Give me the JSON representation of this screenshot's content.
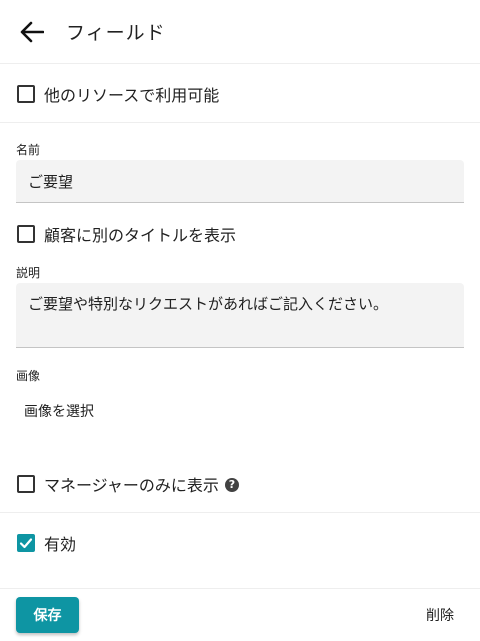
{
  "header": {
    "title": "フィールド"
  },
  "options": {
    "available_other_resources_label": "他のリソースで利用可能",
    "show_different_title_label": "顧客に別のタイトルを表示",
    "managers_only_label": "マネージャーのみに表示",
    "enabled_label": "有効"
  },
  "fields": {
    "name_label": "名前",
    "name_value": "ご要望",
    "description_label": "説明",
    "description_value": "ご要望や特別なリクエストがあればご記入ください。",
    "image_label": "画像",
    "select_image_label": "画像を選択"
  },
  "actions": {
    "save_label": "保存",
    "delete_label": "削除"
  },
  "state": {
    "available_other_resources": false,
    "show_different_title": false,
    "managers_only": false,
    "enabled": true
  },
  "colors": {
    "accent": "#0e95a3"
  }
}
